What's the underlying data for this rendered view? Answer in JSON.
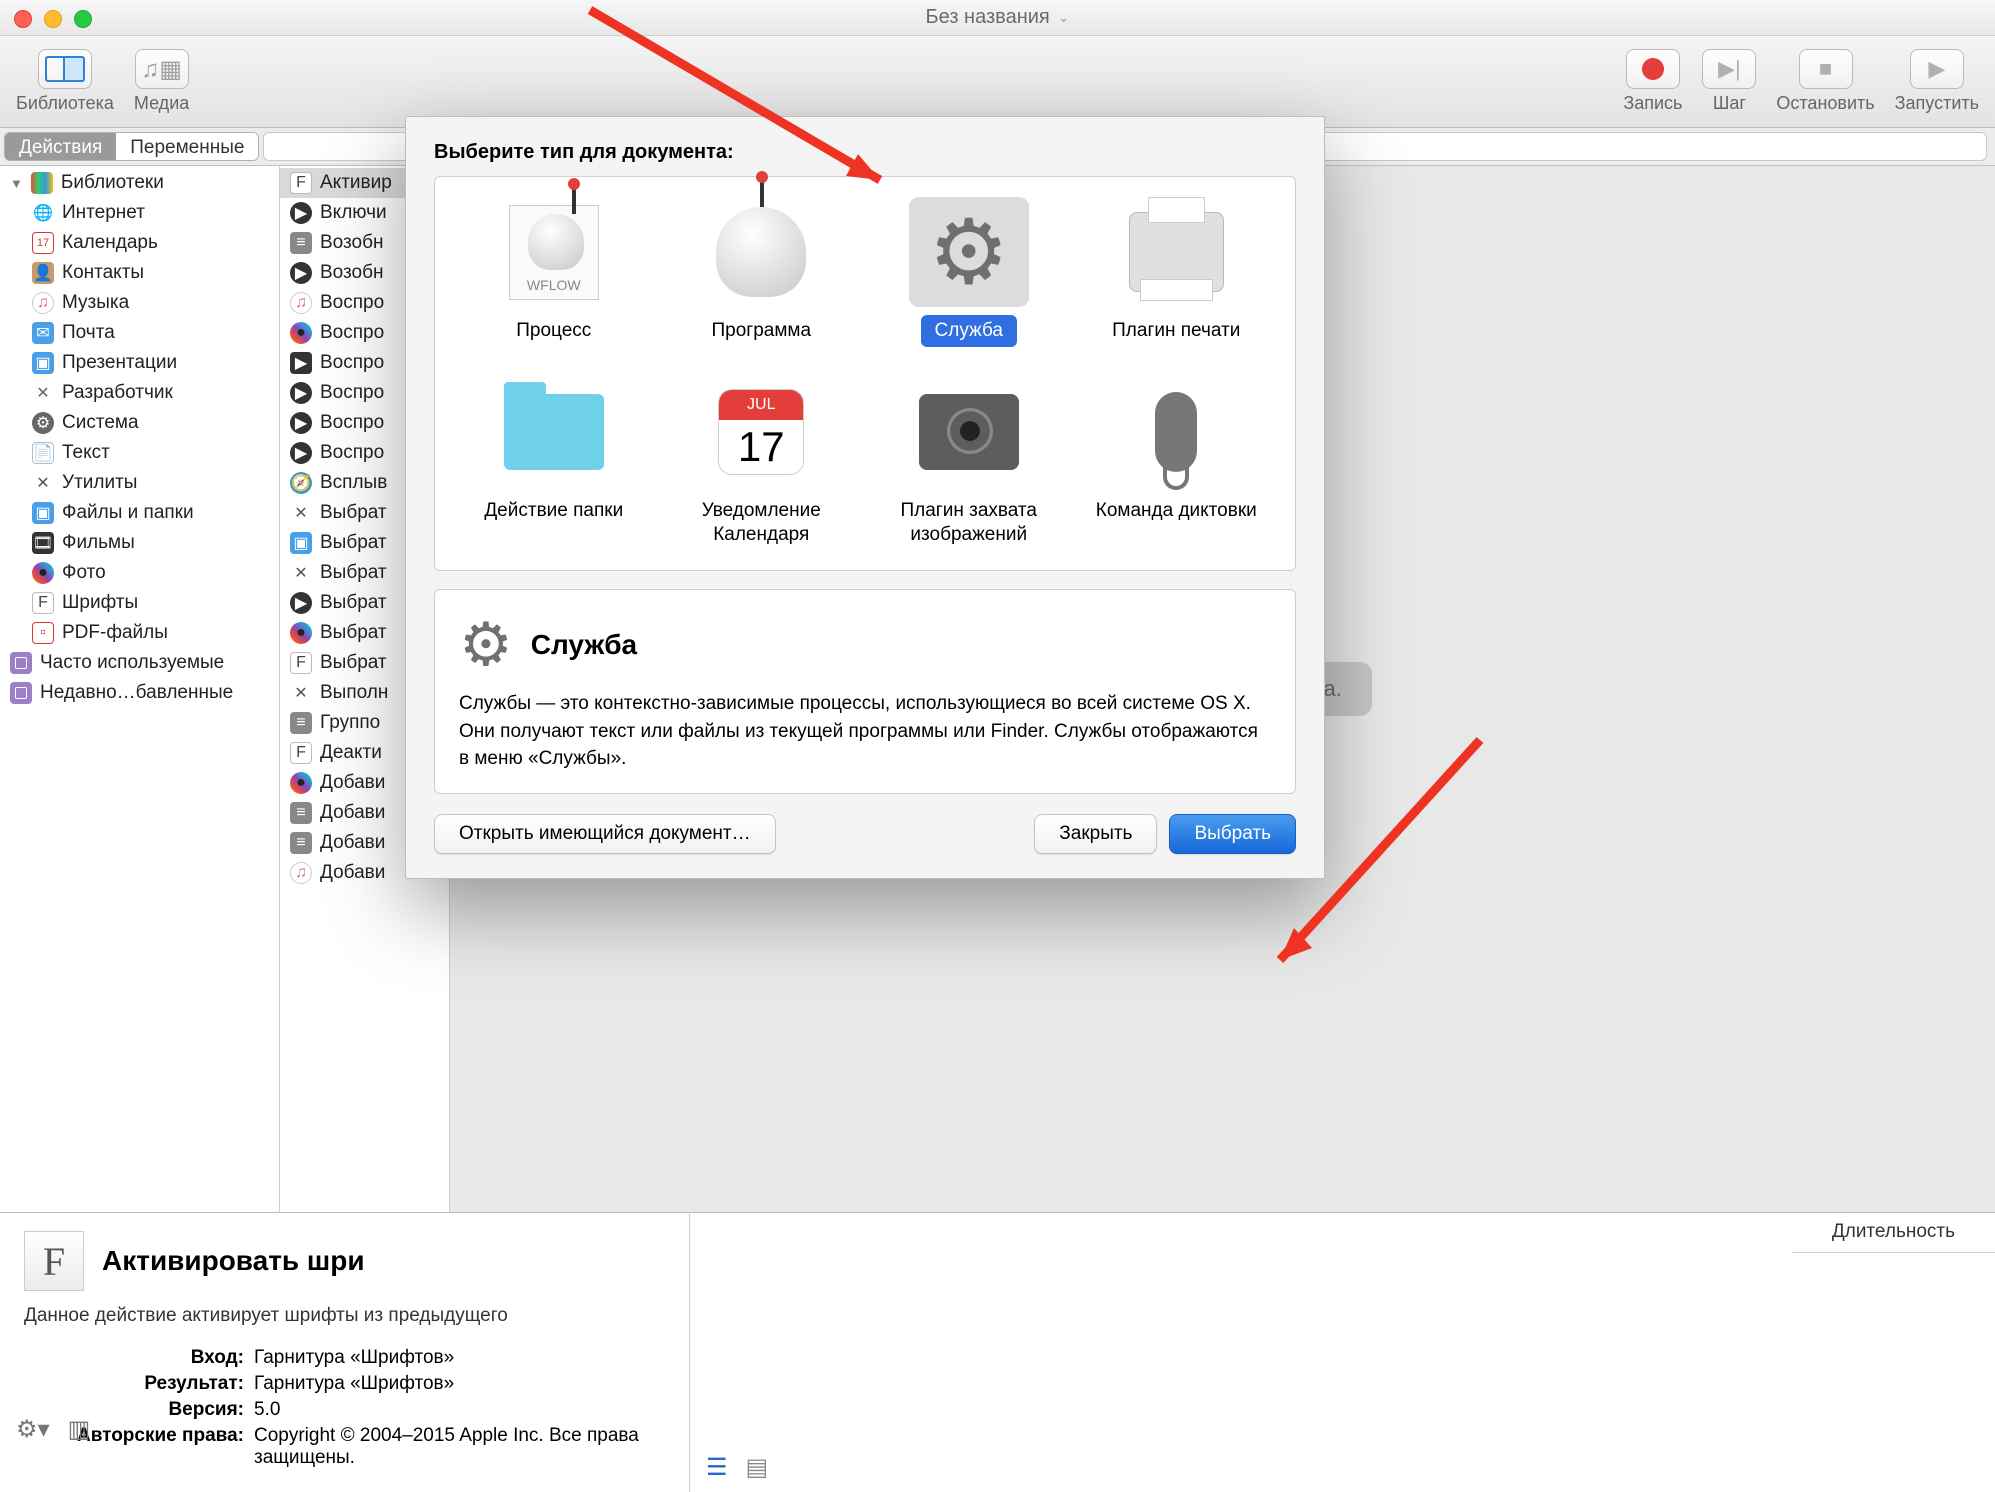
{
  "window": {
    "title": "Без названия"
  },
  "toolbar": {
    "library": "Библиотека",
    "media": "Медиа",
    "record": "Запись",
    "step": "Шаг",
    "stop": "Остановить",
    "run": "Запустить"
  },
  "tabs": {
    "actions": "Действия",
    "variables": "Переменные"
  },
  "library": {
    "root": "Библиотеки",
    "items": [
      "Интернет",
      "Календарь",
      "Контакты",
      "Музыка",
      "Почта",
      "Презентации",
      "Разработчик",
      "Система",
      "Текст",
      "Утилиты",
      "Файлы и папки",
      "Фильмы",
      "Фото",
      "Шрифты",
      "PDF-файлы"
    ],
    "smart": [
      "Часто используемые",
      "Недавно…бавленные"
    ]
  },
  "actions": {
    "selected": "Активир",
    "items": [
      "Активир",
      "Включи",
      "Возобн",
      "Возобн",
      "Воспро",
      "Воспро",
      "Воспро",
      "Воспро",
      "Воспро",
      "Воспро",
      "Всплыв",
      "Выбрат",
      "Выбрат",
      "Выбрат",
      "Выбрат",
      "Выбрат",
      "Выбрат",
      "Выполн",
      "Группо",
      "Деакти",
      "Добави",
      "Добави",
      "Добави",
      "Добави"
    ]
  },
  "canvas": {
    "placeholder": "ания Вашего процесса."
  },
  "detail": {
    "title": "Активировать шри",
    "desc": "Данное действие активирует шрифты из предыдущего",
    "meta": {
      "input_k": "Вход:",
      "input_v": "Гарнитура «Шрифтов»",
      "result_k": "Результат:",
      "result_v": "Гарнитура «Шрифтов»",
      "version_k": "Версия:",
      "version_v": "5.0",
      "copyright_k": "Авторские права:",
      "copyright_v": "Copyright © 2004–2015 Apple Inc. Все права защищены."
    }
  },
  "timeline": {
    "duration": "Длительность"
  },
  "dialog": {
    "title": "Выберите тип для документа:",
    "types": [
      {
        "label": "Процесс"
      },
      {
        "label": "Программа"
      },
      {
        "label": "Служба",
        "selected": true
      },
      {
        "label": "Плагин печати"
      },
      {
        "label": "Действие папки"
      },
      {
        "label": "Уведомление Календаря"
      },
      {
        "label": "Плагин захвата изображений"
      },
      {
        "label": "Команда диктовки"
      }
    ],
    "desc_title": "Служба",
    "desc_text": "Службы — это контекстно-зависимые процессы, использующиеся во всей системе OS X. Они получают текст или файлы из текущей программы или Finder. Службы отображаются в меню «Службы».",
    "open_existing": "Открыть имеющийся документ…",
    "close": "Закрыть",
    "choose": "Выбрать",
    "cal_month": "JUL",
    "cal_day": "17"
  }
}
